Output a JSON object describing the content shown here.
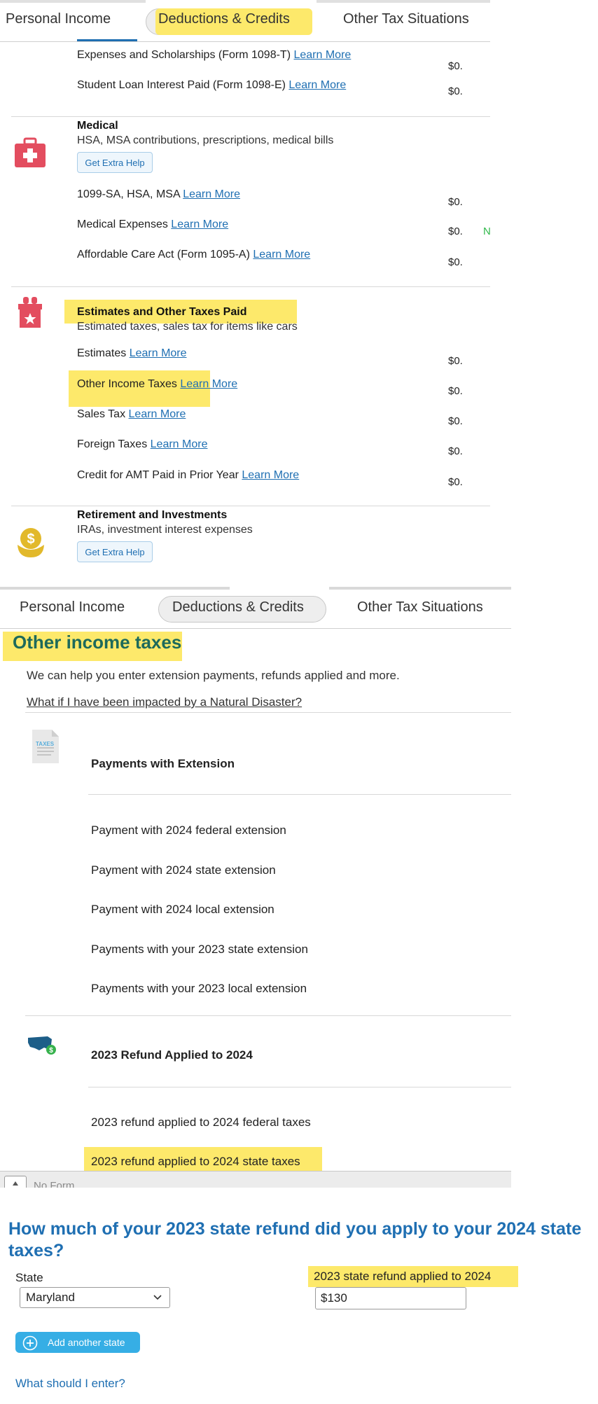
{
  "panel1": {
    "tabs": {
      "personal_income": "Personal Income",
      "deductions_credits": "Deductions & Credits",
      "other_tax_situations": "Other Tax Situations"
    },
    "education_rows": [
      {
        "label": "Expenses and Scholarships (Form 1098-T)",
        "link": "Learn More",
        "amount": "$0."
      },
      {
        "label": "Student Loan Interest Paid (Form 1098-E)",
        "link": "Learn More",
        "amount": "$0."
      }
    ],
    "medical": {
      "title": "Medical",
      "subtitle": "HSA, MSA contributions, prescriptions, medical bills",
      "help_button": "Get Extra Help",
      "rows": [
        {
          "label": "1099-SA, HSA, MSA",
          "link": "Learn More",
          "amount": "$0."
        },
        {
          "label": "Medical Expenses",
          "link": "Learn More",
          "amount": "$0.",
          "badge": "N"
        },
        {
          "label": "Affordable Care Act (Form 1095-A)",
          "link": "Learn More",
          "amount": "$0."
        }
      ]
    },
    "estimates": {
      "title": "Estimates and Other Taxes Paid",
      "subtitle": "Estimated taxes, sales tax for items like cars",
      "rows": [
        {
          "label": "Estimates",
          "link": "Learn More",
          "amount": "$0."
        },
        {
          "label": "Other Income Taxes",
          "link": "Learn More",
          "amount": "$0."
        },
        {
          "label": "Sales Tax",
          "link": "Learn More",
          "amount": "$0."
        },
        {
          "label": "Foreign Taxes",
          "link": "Learn More",
          "amount": "$0."
        },
        {
          "label": "Credit for AMT Paid in Prior Year",
          "link": "Learn More",
          "amount": "$0."
        }
      ]
    },
    "retirement": {
      "title": "Retirement and Investments",
      "subtitle": "IRAs, investment interest expenses",
      "help_button": "Get Extra Help"
    }
  },
  "panel2": {
    "tabs": {
      "personal_income": "Personal Income",
      "deductions_credits": "Deductions & Credits",
      "other_tax_situations": "Other Tax Situations"
    },
    "title": "Other income taxes",
    "intro": "We can help you enter extension payments, refunds applied and more.",
    "disaster_link": "What if I have been impacted by a Natural Disaster?",
    "taxes_icon_text": "TAXES",
    "extension_section": {
      "title": "Payments with Extension",
      "rows": [
        "Payment with 2024 federal extension",
        "Payment with 2024 state extension",
        "Payment with 2024 local extension",
        "Payments with your 2023 state extension",
        "Payments with your 2023 local extension"
      ]
    },
    "refund_section": {
      "title": "2023 Refund Applied to 2024",
      "rows": [
        "2023 refund applied to 2024 federal taxes",
        "2023 refund applied to 2024 state taxes"
      ]
    },
    "footer_text": "No Form"
  },
  "panel3": {
    "question": "How much of your 2023 state refund did you apply to your 2024 state taxes?",
    "state_label": "State",
    "state_value": "Maryland",
    "refund_label": "2023 state refund applied to 2024",
    "refund_value": "$130",
    "add_state_button": "Add another state",
    "help_link": "What should I enter?"
  },
  "colors": {
    "highlight": "#fde96b",
    "link": "#1f6fb2",
    "title_green": "#1d6a5b",
    "medical_red": "#e34d5f",
    "retirement_gold": "#e2b92b",
    "add_button_blue": "#36aee5"
  },
  "icons": {
    "medical": "first-aid-kit-icon",
    "estimates": "gift-box-star-icon",
    "retirement": "money-bag-icon",
    "taxes": "tax-document-icon",
    "refund": "us-map-dollar-icon",
    "select": "chevron-down-icon",
    "add": "plus-circle-icon"
  }
}
